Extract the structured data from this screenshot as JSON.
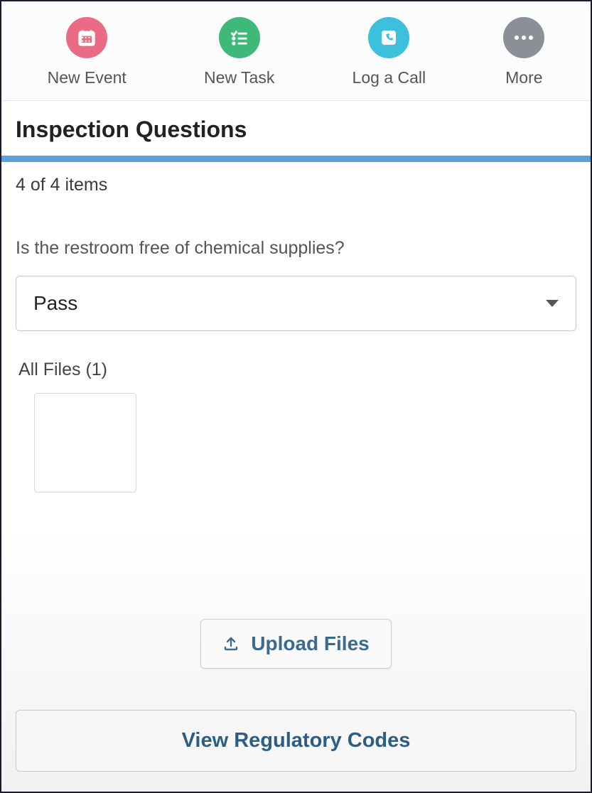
{
  "toolbar": {
    "items": [
      {
        "label": "New Event",
        "icon": "calendar-icon",
        "color": "circle-pink"
      },
      {
        "label": "New Task",
        "icon": "checklist-icon",
        "color": "circle-green"
      },
      {
        "label": "Log a Call",
        "icon": "phone-icon",
        "color": "circle-cyan"
      },
      {
        "label": "More",
        "icon": "more-icon",
        "color": "circle-gray"
      }
    ]
  },
  "section": {
    "title": "Inspection Questions",
    "item_count": "4 of 4 items"
  },
  "question": {
    "label": "Is the restroom free of chemical supplies?",
    "selected_value": "Pass"
  },
  "files": {
    "label": "All Files (1)"
  },
  "actions": {
    "upload_label": "Upload Files",
    "regulatory_label": "View Regulatory Codes"
  }
}
